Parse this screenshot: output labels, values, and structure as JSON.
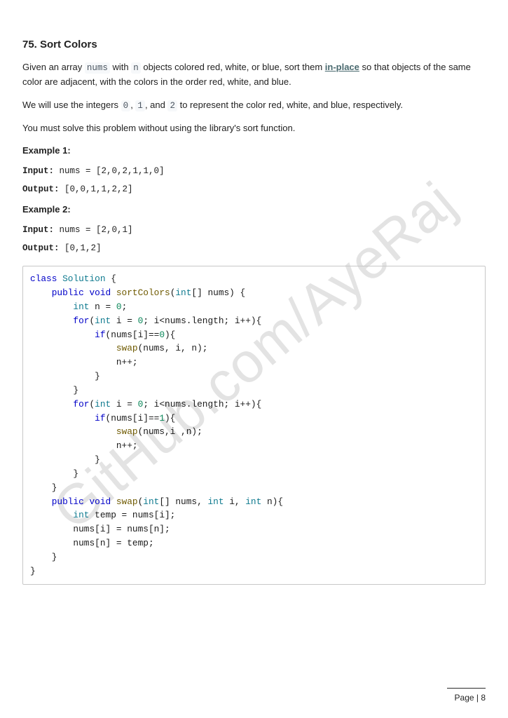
{
  "watermark": "GitHub.com/AyeRaj",
  "title": "75. Sort Colors",
  "para1_pre": "Given an array ",
  "para1_code1": "nums",
  "para1_mid1": " with ",
  "para1_code2": "n",
  "para1_mid2": " objects colored red, white, or blue, sort them ",
  "para1_link": "in-place",
  "para1_post": " so that objects of the same color are adjacent, with the colors in the order red, white, and blue.",
  "para2_pre": "We will use the integers ",
  "para2_c0": "0",
  "para2_s1": ", ",
  "para2_c1": "1",
  "para2_s2": ", and ",
  "para2_c2": "2",
  "para2_post": " to represent the color red, white, and blue, respectively.",
  "para3": "You must solve this problem without using the library's sort function.",
  "ex1_label": "Example 1:",
  "ex1_in_lbl": "Input:",
  "ex1_in_val": " nums = [2,0,2,1,1,0]",
  "ex1_out_lbl": "Output:",
  "ex1_out_val": " [0,0,1,1,2,2]",
  "ex2_label": "Example 2:",
  "ex2_in_lbl": "Input:",
  "ex2_in_val": " nums = [2,0,1]",
  "ex2_out_lbl": "Output:",
  "ex2_out_val": " [0,1,2]",
  "code": {
    "l1a": "class",
    "l1b": " Solution",
    "l1c": " {",
    "l2a": "    public",
    "l2b": " void",
    "l2c": " sortColors",
    "l2d": "(",
    "l2e": "int",
    "l2f": "[] nums) {",
    "l3a": "        int",
    "l3b": " n = ",
    "l3c": "0",
    "l3d": ";",
    "l4a": "        for",
    "l4b": "(",
    "l4c": "int",
    "l4d": " i = ",
    "l4e": "0",
    "l4f": "; i<nums.length; i++){",
    "l5a": "            if",
    "l5b": "(nums[i]==",
    "l5c": "0",
    "l5d": "){",
    "l6a": "                swap",
    "l6b": "(nums, i, n);",
    "l7": "                n++;",
    "l8": "            }",
    "l9": "        }",
    "l10a": "        for",
    "l10b": "(",
    "l10c": "int",
    "l10d": " i = ",
    "l10e": "0",
    "l10f": "; i<nums.length; i++){",
    "l11a": "            if",
    "l11b": "(nums[i]==",
    "l11c": "1",
    "l11d": "){",
    "l12a": "                swap",
    "l12b": "(nums,i ,n);",
    "l13": "                n++;",
    "l14": "            }",
    "l15": "        }",
    "l16": "    }",
    "l17a": "    public",
    "l17b": " void",
    "l17c": " swap",
    "l17d": "(",
    "l17e": "int",
    "l17f": "[] nums, ",
    "l17g": "int",
    "l17h": " i, ",
    "l17i": "int",
    "l17j": " n){",
    "l18a": "        int",
    "l18b": " temp = nums[i];",
    "l19": "        nums[i] = nums[n];",
    "l20": "        nums[n] = temp;",
    "l21": "    }",
    "l22": "}"
  },
  "footer": "Page | 8"
}
